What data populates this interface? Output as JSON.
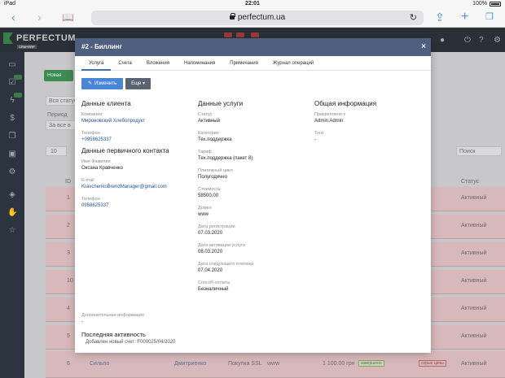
{
  "status_bar": {
    "device": "iPad",
    "time": "22:01",
    "battery": "100%"
  },
  "browser": {
    "url": "perfectum.ua"
  },
  "app": {
    "logo": "PERFECTUM",
    "logo_sub": "CRM+ERP",
    "background": {
      "new_button": "Новая",
      "filter_label": "Вся статус",
      "period_label": "Период",
      "period_value": "За все в",
      "per_page": "10",
      "search_placeholder": "Поиск",
      "id_header": "ID",
      "status_header": "Статус",
      "row_ids": [
        "1",
        "2",
        "3",
        "10",
        "4",
        "5",
        "6"
      ],
      "row_status": "Активный",
      "bottom_row": {
        "id": "6",
        "client": "Сильпо",
        "manager": "Дмитриенко",
        "service": "Покупка SSL",
        "domain": "www",
        "price": "1 100.00 грн",
        "tag": "завершено",
        "action": "серые цены",
        "status": "Активный"
      }
    }
  },
  "modal": {
    "title": "#2 - Биллинг",
    "close": "×",
    "tabs": [
      "Услуга",
      "Счета",
      "Вложения",
      "Напоминания",
      "Примечания",
      "Журнал операций"
    ],
    "actions": {
      "edit": "Изменить",
      "more": "Еще"
    },
    "client": {
      "title": "Данные клиента",
      "company_label": "Компания",
      "company": "Мироновский Хлебопродукт",
      "phone_label": "Телефон",
      "phone": "+0958625337"
    },
    "primary_contact": {
      "title": "Данные первичного контакта",
      "name_label": "Имя Фамилия",
      "name": "Оксана Кравченко",
      "email_label": "E-mail",
      "email": "KravchenkoBrendManager@gmail.com",
      "phone_label": "Телефон",
      "phone": "0958625337"
    },
    "service": {
      "title": "Данные услуги",
      "status_label": "Статус",
      "status": "Активный",
      "category_label": "Категория",
      "category": "Тех.поддержка",
      "tariff_label": "Тариф",
      "tariff": "Тех.поддержка (пакет 8)",
      "payment_cycle_label": "Платежный цикл",
      "payment_cycle": "Полугодично",
      "cost_label": "Стоимость",
      "cost": "58500.00",
      "domain_label": "Домен",
      "domain": "www",
      "reg_date_label": "Дата регистрации",
      "reg_date": "07.03.2020",
      "activation_date_label": "Дата активации услуги",
      "activation_date": "08.03.2020",
      "next_payment_label": "Дата следующего платежа",
      "next_payment": "07.04.2020",
      "payment_method_label": "Способ оплаты",
      "payment_method": "Безналичный"
    },
    "general": {
      "title": "Общая информация",
      "assigned_label": "Прикреплено к",
      "assigned": "Admin Admin",
      "tags_label": "Теги",
      "tags": "-"
    },
    "additional": {
      "label": "Дополнительная информация",
      "value": "-"
    },
    "activity": {
      "title": "Последняя активность",
      "note": "Добавлен новый счет: F000025/04/2020"
    }
  }
}
